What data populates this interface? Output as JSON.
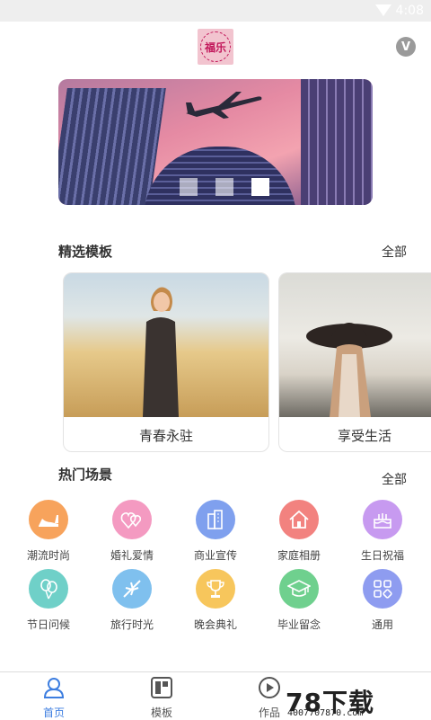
{
  "status_bar": {
    "time": "4:08"
  },
  "header": {
    "logo_text": "福乐"
  },
  "banner": {
    "dots": 3,
    "active_dot": 3
  },
  "featured": {
    "title": "精选模板",
    "more": "全部",
    "cards": [
      {
        "name": "青春永驻"
      },
      {
        "name": "享受生活"
      }
    ]
  },
  "scenes": {
    "title": "热门场景",
    "more": "全部",
    "items": [
      {
        "label": "潮流时尚",
        "color": "#f7a35c",
        "icon": "high-heel-icon"
      },
      {
        "label": "婚礼爱情",
        "color": "#f49ac1",
        "icon": "hearts-icon"
      },
      {
        "label": "商业宣传",
        "color": "#7fa0ee",
        "icon": "building-icon"
      },
      {
        "label": "家庭相册",
        "color": "#f2827f",
        "icon": "house-icon"
      },
      {
        "label": "生日祝福",
        "color": "#c79af0",
        "icon": "cake-icon"
      },
      {
        "label": "节日问候",
        "color": "#6fd0c8",
        "icon": "balloon-icon"
      },
      {
        "label": "旅行时光",
        "color": "#7fc0ee",
        "icon": "airplane-icon"
      },
      {
        "label": "晚会典礼",
        "color": "#f7c65c",
        "icon": "trophy-icon"
      },
      {
        "label": "毕业留念",
        "color": "#6fd08e",
        "icon": "graduation-cap-icon"
      },
      {
        "label": "通用",
        "color": "#8e9cf0",
        "icon": "grid-icon"
      }
    ]
  },
  "tabbar": {
    "tabs": [
      {
        "label": "首页",
        "active": true
      },
      {
        "label": "模板",
        "active": false
      },
      {
        "label": "作品",
        "active": false
      }
    ]
  },
  "watermark": {
    "logo": "78下载",
    "url": "4007707870.com"
  }
}
